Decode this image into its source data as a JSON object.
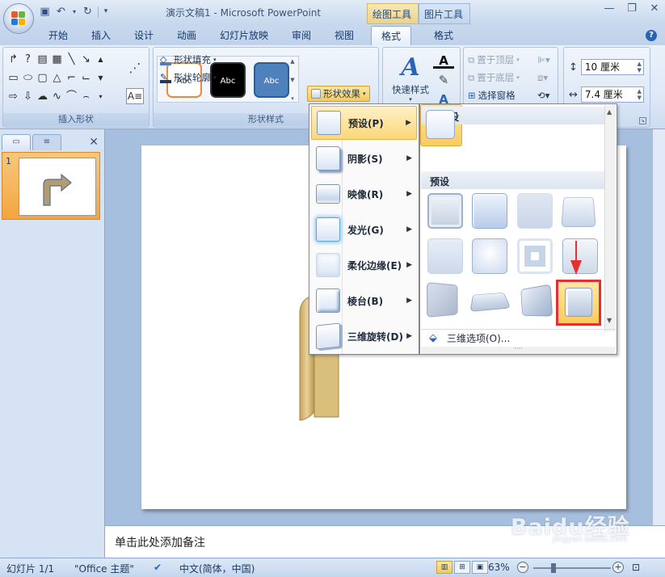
{
  "window": {
    "title": "演示文稿1 - Microsoft PowerPoint",
    "context_tabs": {
      "drawing_tools": "绘图工具",
      "picture_tools": "图片工具"
    }
  },
  "tabs": [
    {
      "label": "开始"
    },
    {
      "label": "插入"
    },
    {
      "label": "设计"
    },
    {
      "label": "动画"
    },
    {
      "label": "幻灯片放映"
    },
    {
      "label": "审阅"
    },
    {
      "label": "视图"
    },
    {
      "label": "格式"
    },
    {
      "label": "格式"
    }
  ],
  "ribbon": {
    "insert_shapes_label": "插入形状",
    "shape_styles_label": "形状样式",
    "style_swatches": [
      {
        "text": "Abc"
      },
      {
        "text": "Abc"
      },
      {
        "text": "Abc"
      }
    ],
    "shape_fill": "形状填充",
    "shape_outline": "形状轮廓",
    "shape_effects": "形状效果",
    "quick_styles": "快速样式",
    "bring_to_front": "置于顶层",
    "send_to_back": "置于底层",
    "selection_pane": "选择窗格",
    "height_value": "10 厘米",
    "width_value": "7.4 厘米"
  },
  "effects_menu": {
    "items": [
      {
        "label": "预设(P)",
        "active": true
      },
      {
        "label": "阴影(S)"
      },
      {
        "label": "映像(R)"
      },
      {
        "label": "发光(G)"
      },
      {
        "label": "柔化边缘(E)"
      },
      {
        "label": "棱台(B)"
      },
      {
        "label": "三维旋转(D)"
      }
    ]
  },
  "preset_submenu": {
    "no_preset_header": "无预设",
    "preset_header": "预设",
    "three_d_options": "三维选项(O)..."
  },
  "left_pane": {
    "slide_number": "1"
  },
  "notes": {
    "placeholder": "单击此处添加备注"
  },
  "status": {
    "slide": "幻灯片 1/1",
    "theme": "\"Office 主题\"",
    "language": "中文(简体，中国)",
    "zoom": "63%"
  },
  "watermark": {
    "main": "Baidu经验",
    "sub": "jingyan.baidu.com"
  },
  "colors": {
    "accent": "#2a64b6",
    "highlight": "#fbcb5c",
    "callout_red": "#e53030"
  }
}
